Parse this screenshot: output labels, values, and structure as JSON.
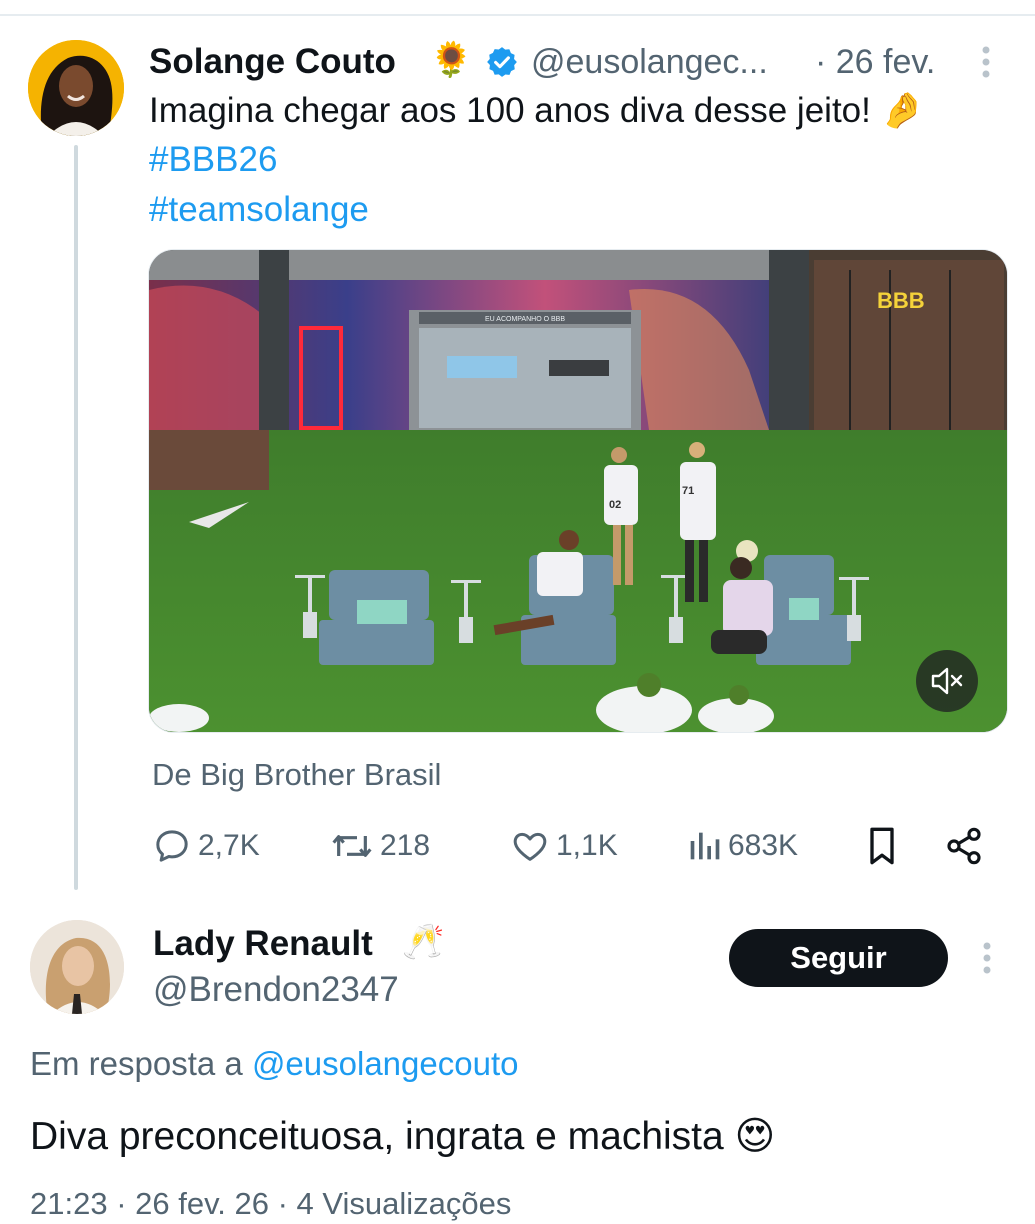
{
  "tweet": {
    "author_name": "Solange Couto",
    "author_emoji": "🌻",
    "author_handle": "@eusolangec...",
    "date": "· 26 fev.",
    "text": "Imagina chegar aos 100 anos diva desse jeito! 🤌",
    "hashtags": [
      "#BBB26",
      "#teamsolange"
    ],
    "media": {
      "source_label": "De Big Brother Brasil",
      "sign": "BBB",
      "door_sign": "EU ACOMPANHO O BBB",
      "jersey_numbers": [
        "02",
        "71"
      ]
    },
    "stats": {
      "replies": "2,7K",
      "reposts": "218",
      "likes": "1,1K",
      "views": "683K"
    }
  },
  "reply": {
    "author_name": "Lady Renault",
    "author_emoji": "🥂",
    "author_handle": "@Brendon2347",
    "follow_label": "Seguir",
    "reply_to_prefix": "Em resposta a",
    "reply_to_handle": "@eusolangecouto",
    "text": "Diva preconceituosa, ingrata e machista 😍",
    "meta_partial": "21:23 · 26 fev. 26 · 4 Visualizações"
  },
  "colors": {
    "accent": "#1d9bf0",
    "text": "#0f1419",
    "secondary": "#536471",
    "button_bg": "#0f1419",
    "divider": "#cfd9de"
  }
}
